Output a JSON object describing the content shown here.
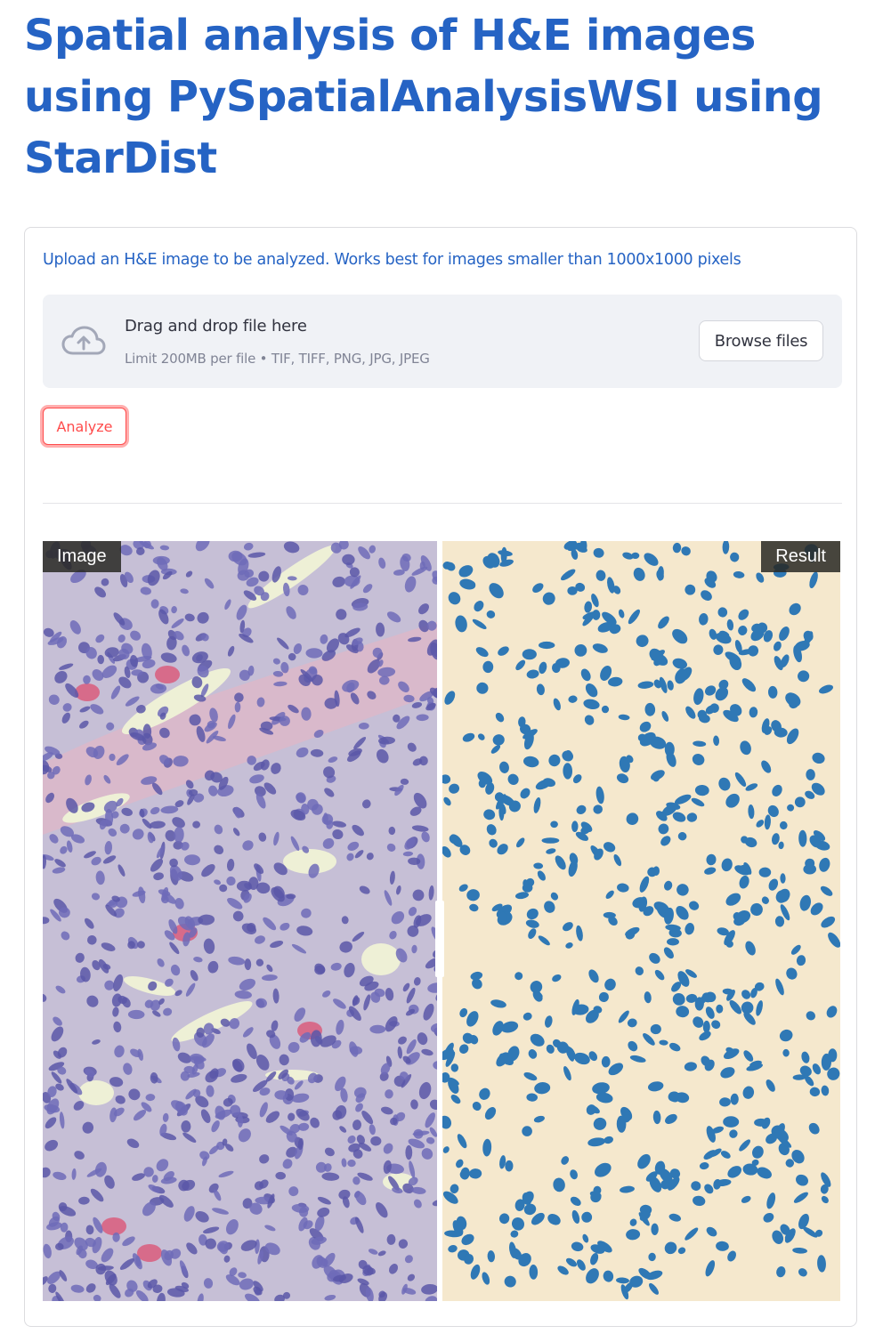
{
  "title": "Spatial analysis of H&E images using PySpatialAnalysisWSI using StarDist",
  "uploader": {
    "label": "Upload an H&E image to be analyzed. Works best for images smaller than 1000x1000 pixels",
    "dropzone_title": "Drag and drop file here",
    "dropzone_hint": "Limit 200MB per file • TIF, TIFF, PNG, JPG, JPEG",
    "browse_label": "Browse files",
    "icon": "cloud-upload-icon"
  },
  "analyze_label": "Analyze",
  "comparison": {
    "left_label": "Image",
    "right_label": "Result",
    "left_description": "H&E stained tissue",
    "right_description": "segmented nuclei"
  },
  "colors": {
    "title": "#2563c4",
    "accent": "#ff4b4b",
    "dropzone_bg": "#f0f2f6",
    "result_bg": "#f5e8cd",
    "nucleus": "#2f78b5",
    "tissue_bg": "#c6bfd6",
    "tissue_nucleus": "#5b57a8"
  }
}
